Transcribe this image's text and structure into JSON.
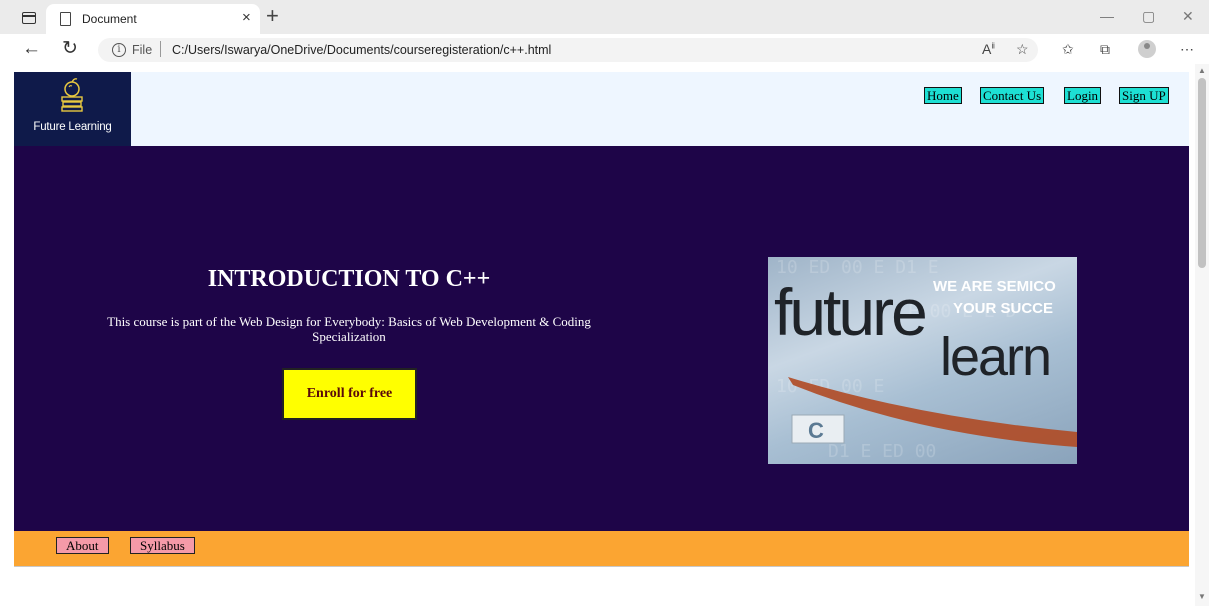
{
  "browser": {
    "tab_title": "Document",
    "tab_close": "×",
    "new_tab": "+",
    "url_scheme": "File",
    "url": "C:/Users/Iswarya/OneDrive/Documents/courseregisteration/c++.html",
    "window_controls": [
      "—",
      "▢",
      "✕"
    ]
  },
  "site": {
    "logo_text": "Future Learning",
    "nav": [
      "Home",
      "Contact Us",
      "Login",
      "Sign UP"
    ]
  },
  "hero": {
    "title": "INTRODUCTION TO C++",
    "description": "This course is part of the Web Design for Everybody: Basics of Web Development & Coding Specialization",
    "enroll_label": "Enroll for free",
    "image": {
      "word1": "future",
      "word2": "learn",
      "banner1": "WE ARE SEMICO",
      "banner2": "YOUR SUCCE",
      "badge": "C"
    }
  },
  "footer": {
    "links": [
      "About",
      "Syllabus"
    ]
  },
  "colors": {
    "hero_bg": "#1e0548",
    "header_bg": "#eef6ff",
    "logo_bg": "#0f1a4a",
    "nav_bg": "#1de0d4",
    "enroll_bg": "#ffff00",
    "footer_bg": "#fba532",
    "footer_link_bg": "#f59aa8"
  }
}
